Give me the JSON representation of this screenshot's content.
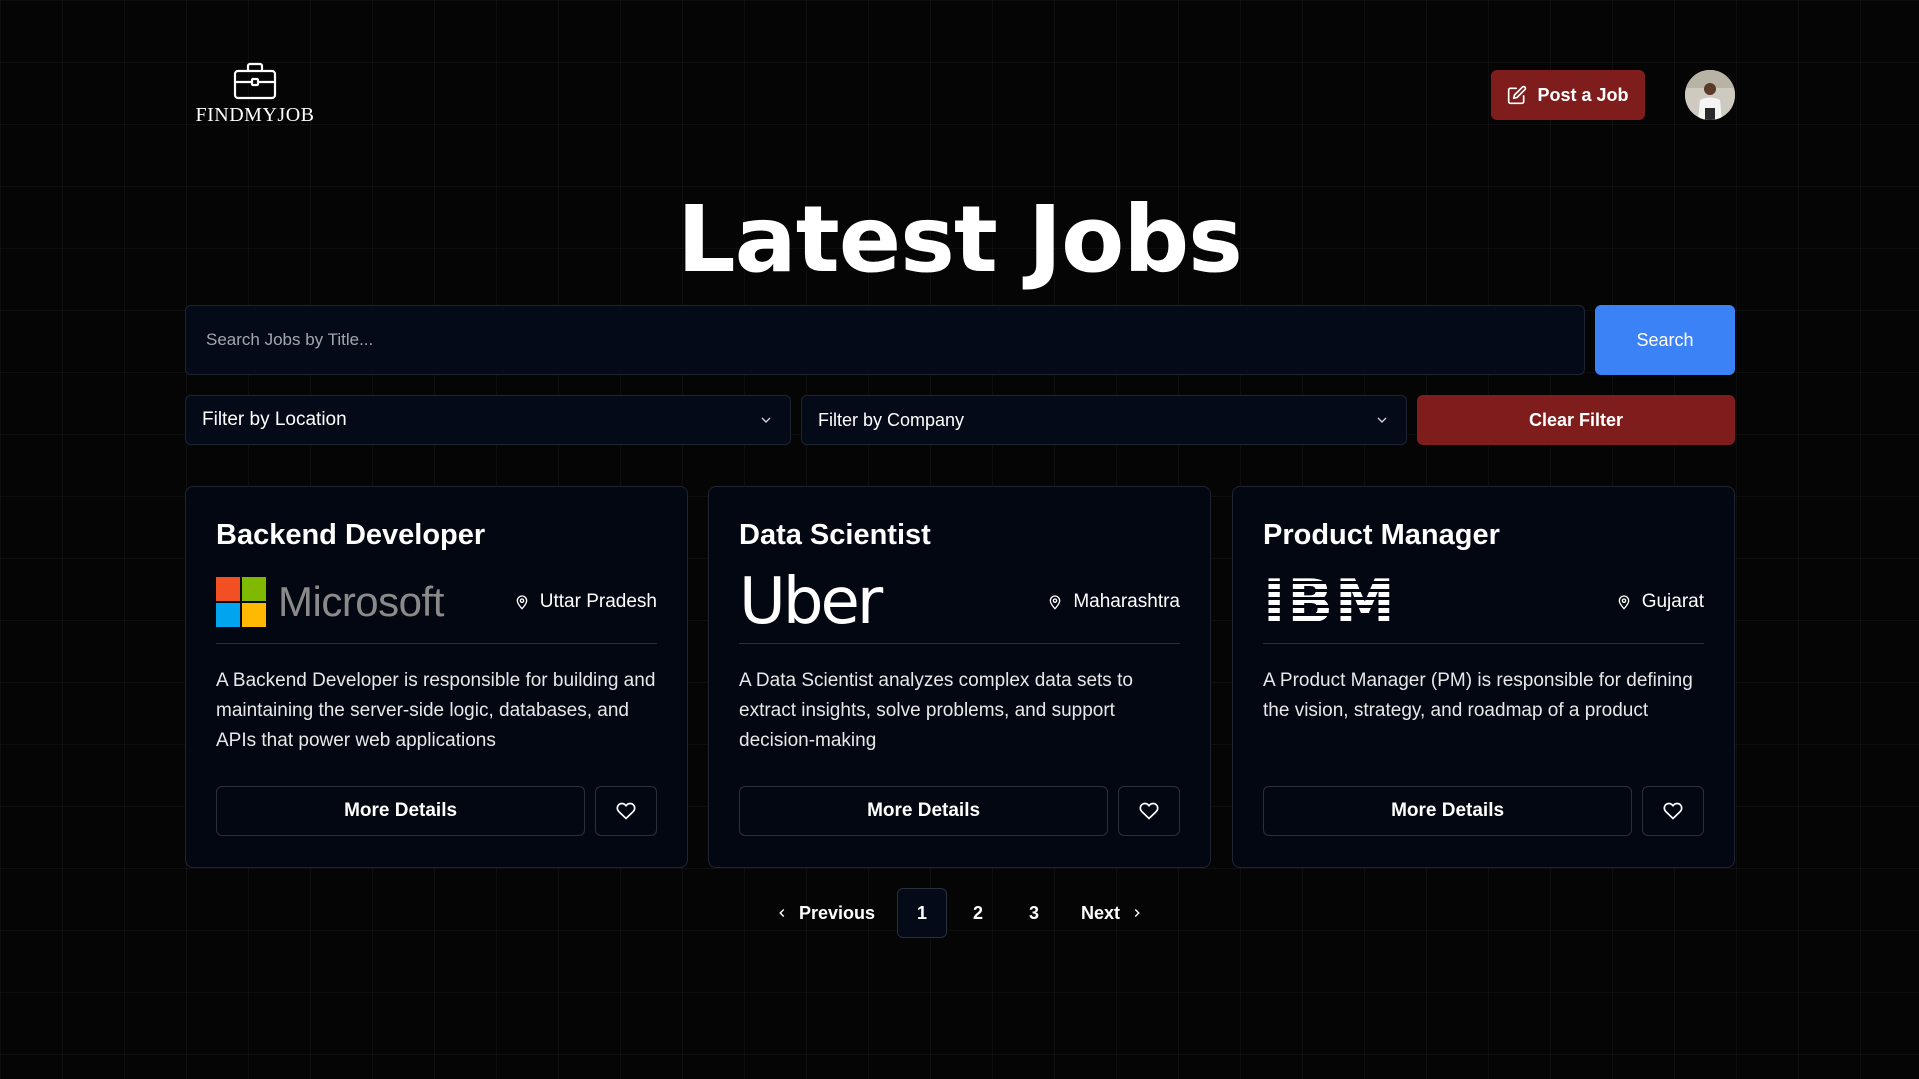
{
  "brand": {
    "name": "FINDMYJOB",
    "logo_icon": "briefcase-icon"
  },
  "header": {
    "post_job_label": "Post a Job",
    "post_job_icon": "edit-icon",
    "avatar": "user-avatar"
  },
  "hero": {
    "title": "Latest Jobs"
  },
  "search": {
    "placeholder": "Search Jobs by Title...",
    "button_label": "Search"
  },
  "filters": {
    "location_label": "Filter by Location",
    "company_label": "Filter by Company",
    "clear_label": "Clear Filter"
  },
  "jobs": [
    {
      "title": "Backend Developer",
      "company": "Microsoft",
      "location": "Uttar Pradesh",
      "description": "A Backend Developer is responsible for building and maintaining the server-side logic, databases, and APIs that power web applications",
      "details_label": "More Details"
    },
    {
      "title": "Data Scientist",
      "company": "Uber",
      "location": "Maharashtra",
      "description": "A Data Scientist analyzes complex data sets to extract insights, solve problems, and support decision-making",
      "details_label": "More Details"
    },
    {
      "title": "Product Manager",
      "company": "IBM",
      "location": "Gujarat",
      "description": "A Product Manager (PM) is responsible for defining the vision, strategy, and roadmap of a product",
      "details_label": "More Details"
    }
  ],
  "pagination": {
    "previous_label": "Previous",
    "next_label": "Next",
    "pages": [
      "1",
      "2",
      "3"
    ],
    "current": "1"
  },
  "colors": {
    "background": "#050505",
    "card": "#030712",
    "primary_blue": "#3b82f6",
    "danger_red": "#7f1d1d"
  }
}
